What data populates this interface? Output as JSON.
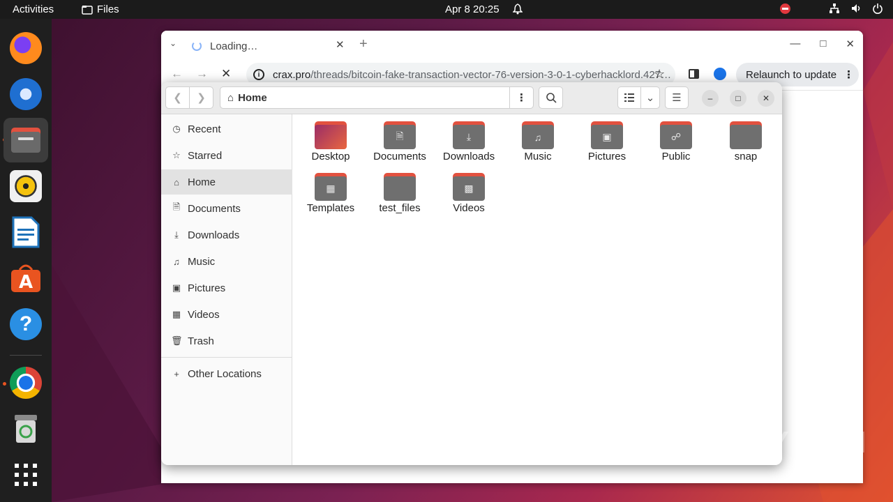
{
  "topbar": {
    "activities": "Activities",
    "app_name": "Files",
    "clock": "Apr 8  20:25"
  },
  "browser": {
    "tab_title": "Loading…",
    "url_domain": "crax.pro",
    "url_path": "/threads/bitcoin-fake-transaction-vector-76-version-3-0-1-cyberhacklord.427…",
    "relaunch_label": "Relaunch to update"
  },
  "files": {
    "path_label": "Home",
    "sidebar": [
      {
        "label": "Recent",
        "icon": "clock-icon"
      },
      {
        "label": "Starred",
        "icon": "star-icon"
      },
      {
        "label": "Home",
        "icon": "home-icon"
      },
      {
        "label": "Documents",
        "icon": "document-icon"
      },
      {
        "label": "Downloads",
        "icon": "download-icon"
      },
      {
        "label": "Music",
        "icon": "music-icon"
      },
      {
        "label": "Pictures",
        "icon": "picture-icon"
      },
      {
        "label": "Videos",
        "icon": "video-icon"
      },
      {
        "label": "Trash",
        "icon": "trash-icon"
      },
      {
        "label": "Other Locations",
        "icon": "plus-icon"
      }
    ],
    "folders": [
      {
        "label": "Desktop",
        "icon": "desktop-folder-icon"
      },
      {
        "label": "Documents",
        "icon": "documents-folder-icon"
      },
      {
        "label": "Downloads",
        "icon": "downloads-folder-icon"
      },
      {
        "label": "Music",
        "icon": "music-folder-icon"
      },
      {
        "label": "Pictures",
        "icon": "pictures-folder-icon"
      },
      {
        "label": "Public",
        "icon": "public-folder-icon"
      },
      {
        "label": "snap",
        "icon": "folder-icon"
      },
      {
        "label": "Templates",
        "icon": "templates-folder-icon"
      },
      {
        "label": "test_files",
        "icon": "folder-icon"
      },
      {
        "label": "Videos",
        "icon": "videos-folder-icon"
      }
    ]
  },
  "watermark": "ANY RUN",
  "colors": {
    "accent": "#e95420",
    "folder_tab": "#e2513f",
    "folder_body": "#6f6f6f"
  }
}
